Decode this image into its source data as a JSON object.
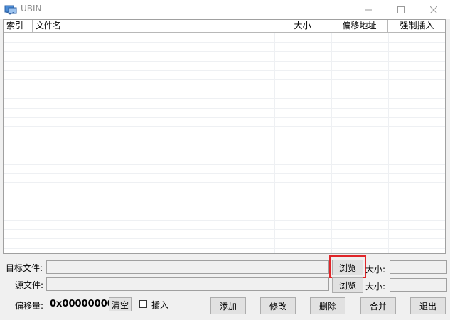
{
  "window": {
    "title": "UBIN"
  },
  "list": {
    "columns": [
      "索引",
      "文件名",
      "大小",
      "偏移地址",
      "强制插入"
    ]
  },
  "target_file": {
    "label": "目标文件:",
    "value": "",
    "browse_label": "浏览",
    "size_label": "大小:",
    "size_value": ""
  },
  "source_file": {
    "label": "源文件:",
    "value": "",
    "browse_label": "浏览",
    "size_label": "大小:",
    "size_value": ""
  },
  "offset": {
    "label": "偏移量:",
    "value": "0x00000000",
    "clear_label": "清空"
  },
  "insert_checkbox": {
    "label": "插入",
    "checked": false
  },
  "actions": {
    "add": "添加",
    "modify": "修改",
    "delete": "删除",
    "merge": "合并",
    "exit": "退出"
  },
  "colors": {
    "highlight": "#e0262a"
  }
}
